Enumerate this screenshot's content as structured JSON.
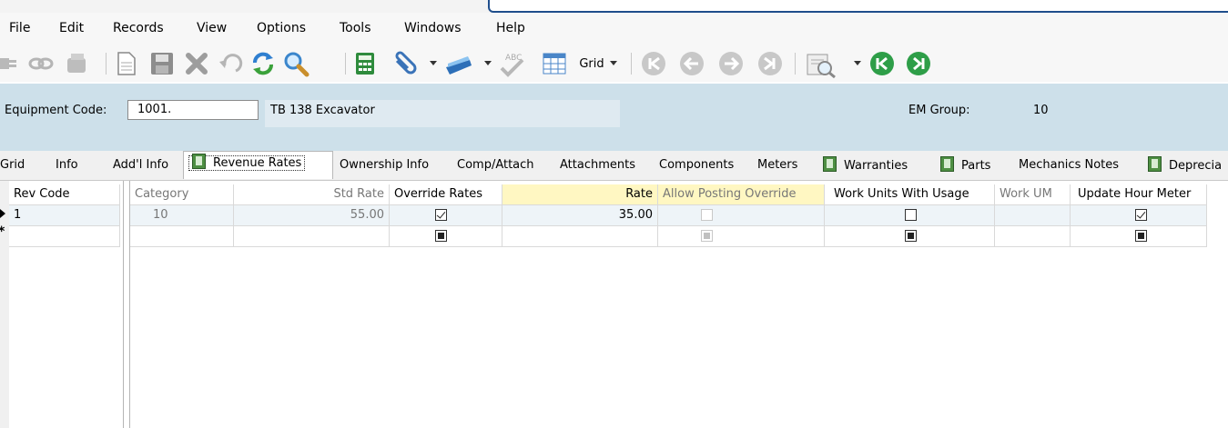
{
  "window": {
    "title": ""
  },
  "menu": [
    "File",
    "Edit",
    "Records",
    "View",
    "Options",
    "Tools",
    "Windows",
    "Help"
  ],
  "toolbar": {
    "grid_label": "Grid"
  },
  "header": {
    "equipment_code_label": "Equipment Code:",
    "equipment_code_value": "1001.",
    "equipment_description": "TB 138 Excavator",
    "em_group_label": "EM Group:",
    "em_group_value": "10"
  },
  "tabs": [
    {
      "label": "Grid"
    },
    {
      "label": "Info"
    },
    {
      "label": "Add'l Info"
    },
    {
      "label": "Revenue Rates",
      "icon": "form-icon",
      "active": true
    },
    {
      "label": "Ownership Info"
    },
    {
      "label": "Comp/Attach"
    },
    {
      "label": "Attachments"
    },
    {
      "label": "Components"
    },
    {
      "label": "Meters"
    },
    {
      "label": "Warranties",
      "icon": "form-icon"
    },
    {
      "label": "Parts",
      "icon": "form-icon"
    },
    {
      "label": "Mechanics Notes"
    },
    {
      "label": "Deprecia",
      "icon": "form-icon"
    }
  ],
  "left_grid": {
    "header": "Rev Code",
    "rows": [
      {
        "value": "1"
      },
      {
        "value": ""
      }
    ]
  },
  "main_grid": {
    "columns": [
      "Category",
      "Std Rate",
      "Override Rates",
      "Rate",
      "Allow Posting Override",
      "Work Units With Usage",
      "Work UM",
      "Update Hour Meter"
    ],
    "rows": [
      {
        "category": "10",
        "std_rate": "55.00",
        "override_rates": "checked",
        "rate": "35.00",
        "allow_posting_override": "unchecked-disabled",
        "work_units_with_usage": "unchecked",
        "work_um": "",
        "update_hour_meter": "checked"
      },
      {
        "category": "",
        "std_rate": "",
        "override_rates": "indeterminate",
        "rate": "",
        "allow_posting_override": "indeterminate-disabled",
        "work_units_with_usage": "indeterminate",
        "work_um": "",
        "update_hour_meter": "indeterminate"
      }
    ]
  },
  "colors": {
    "header_band": "#cde0ea",
    "rate_header": "#fff7c2",
    "accent": "#1f4e8c"
  }
}
